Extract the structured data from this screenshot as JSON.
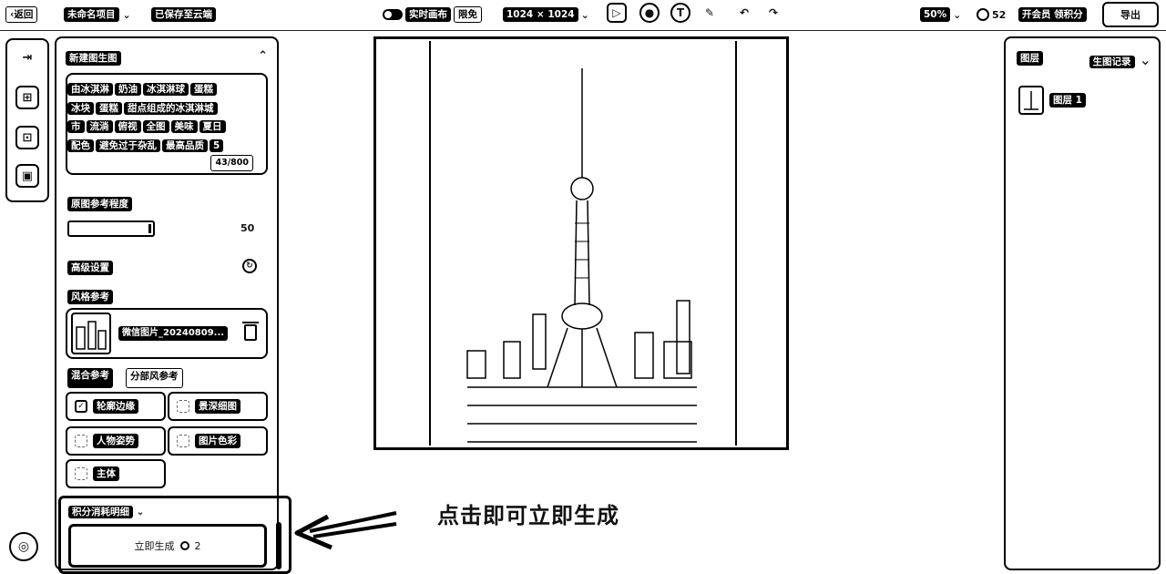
{
  "topbar": {
    "back": "返回",
    "project_name": "未命名项目",
    "save_status": "已保存至云端",
    "realtime_label": "实时画布",
    "realtime_tag": "限免",
    "canvas_size": "1024 × 1024",
    "zoom": "50%",
    "points": "52",
    "member_label": "开会员 领积分",
    "export_label": "导出"
  },
  "panel": {
    "title": "新建图生图",
    "prompt_chips": [
      "由冰淇淋",
      "奶油",
      "冰淇淋球",
      "蛋糕",
      "冰块",
      "蛋糕",
      "甜点组成的冰淇淋城",
      "市",
      "流淌",
      "俯视",
      "全图",
      "美味",
      "夏日",
      "配色",
      "避免过于杂乱",
      "最高品质",
      "5"
    ],
    "prompt_count": "43/800",
    "ref_strength_label": "原图参考程度",
    "ref_strength_value": "50",
    "advanced_label": "高级设置",
    "style_ref_label": "风格参考",
    "style_file": "微信图片_20240809...",
    "tabs": [
      "混合参考",
      "分部风参考"
    ],
    "options": [
      {
        "label": "轮廓边缘",
        "checked": true
      },
      {
        "label": "景深细图",
        "checked": false
      },
      {
        "label": "人物姿势",
        "checked": false
      },
      {
        "label": "图片色彩",
        "checked": false
      },
      {
        "label": "主体",
        "checked": false
      }
    ],
    "points_detail": "积分消耗明细",
    "generate_label": "立即生成",
    "generate_cost": "2"
  },
  "callout": "点击即可立即生成",
  "right_panel": {
    "title": "图层",
    "history": "生图记录",
    "layers": [
      "图层 1"
    ]
  }
}
